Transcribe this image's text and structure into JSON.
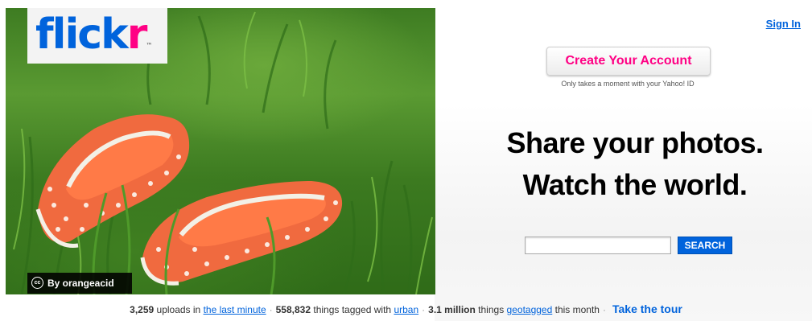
{
  "brand": {
    "logo_part1": "flick",
    "logo_part2": "r",
    "logo_tm": "™",
    "blue": "#0063dc",
    "pink": "#ff0084"
  },
  "header": {
    "sign_in": "Sign In"
  },
  "hero": {
    "credit_icon": "creative-commons-icon",
    "credit_icon_text": "cc",
    "credit_text": "By orangeacid"
  },
  "signup": {
    "button_label": "Create Your Account",
    "note": "Only takes a moment with your Yahoo! ID"
  },
  "tagline": {
    "line1": "Share your photos.",
    "line2": "Watch the world."
  },
  "search": {
    "value": "",
    "button_label": "SEARCH"
  },
  "stats": {
    "uploads_count": "3,259",
    "uploads_text": "uploads in",
    "uploads_link": "the last minute",
    "tagged_count": "558,832",
    "tagged_text": "things tagged with",
    "tagged_link": "urban",
    "geo_count": "3.1 million",
    "geo_text": "things",
    "geo_link": "geotagged",
    "geo_suffix": "this month",
    "separator": "·",
    "tour_link": "Take the tour"
  }
}
